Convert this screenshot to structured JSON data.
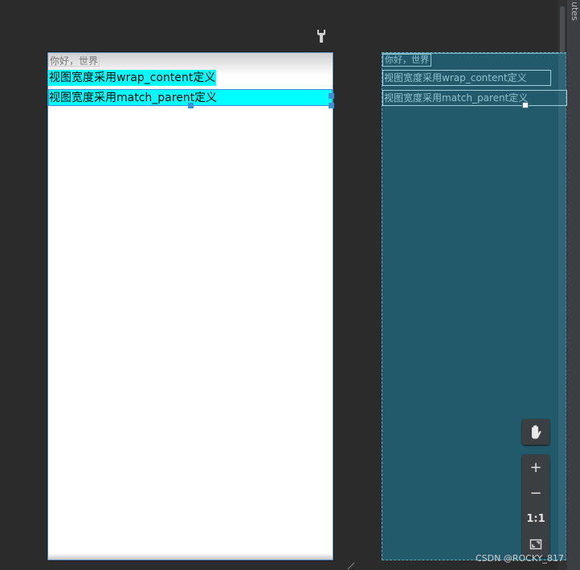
{
  "side_panel": {
    "tab_label": "utes"
  },
  "design_view": {
    "hello_text": "你好，世界",
    "wrap_text": "视图宽度采用wrap_content定义",
    "match_text": "视图宽度采用match_parent定义",
    "highlight_color": "#00ffff"
  },
  "blueprint_view": {
    "hello_text": "你好，世界",
    "wrap_text": "视图宽度采用wrap_content定义",
    "match_text": "视图宽度采用match_parent定义",
    "background_color": "#235a6b"
  },
  "toolbar": {
    "pan_icon": "hand-icon",
    "zoom_in_label": "+",
    "zoom_out_label": "−",
    "actual_size_label": "1:1",
    "fit_icon": "fit-screen-icon"
  },
  "watermark": "CSDN @ROCKY_817"
}
